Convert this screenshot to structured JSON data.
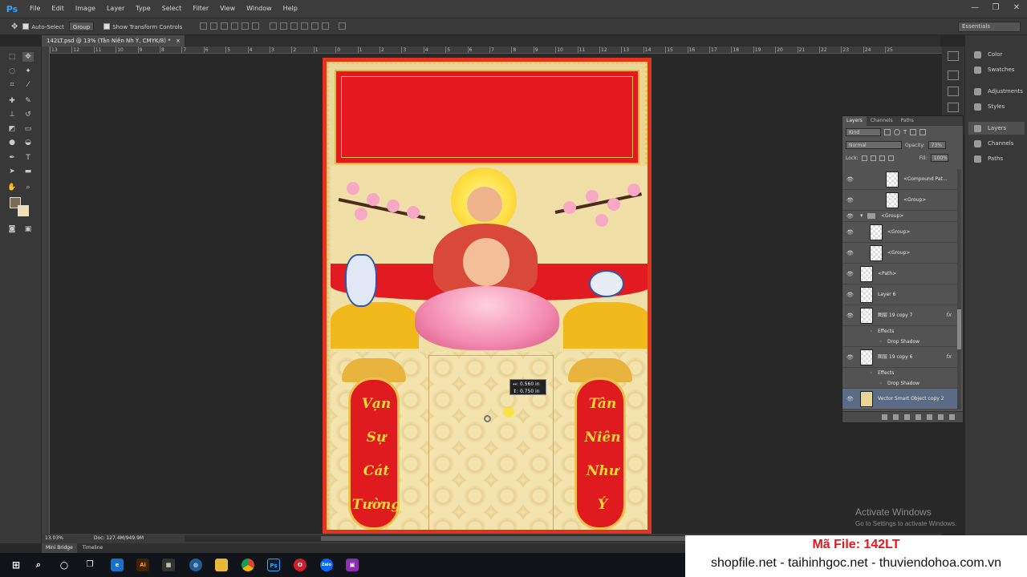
{
  "app": {
    "logo": "Ps",
    "menu": [
      "File",
      "Edit",
      "Image",
      "Layer",
      "Type",
      "Select",
      "Filter",
      "View",
      "Window",
      "Help"
    ],
    "window_controls": [
      "—",
      "❐",
      "✕"
    ]
  },
  "options_bar": {
    "auto_select_label": "Auto-Select",
    "auto_select_target": "Group",
    "show_transform_label": "Show Transform Controls",
    "workspace": "Essentials"
  },
  "document": {
    "tab_title": "142LT.psd @ 13% (Tân Niên Nh Ý, CMYK/8) *",
    "tab_close": "×",
    "ruler_ticks": [
      "13",
      "12",
      "11",
      "10",
      "9",
      "8",
      "7",
      "6",
      "5",
      "4",
      "3",
      "2",
      "1",
      "0",
      "1",
      "2",
      "3",
      "4",
      "5",
      "6",
      "7",
      "8",
      "9",
      "10",
      "11",
      "12",
      "13",
      "14",
      "15",
      "16",
      "17",
      "18",
      "19",
      "20",
      "21",
      "22",
      "23",
      "24",
      "25"
    ],
    "left_scroll_text": [
      "Vạn",
      "Sự",
      "Cát",
      "Tường"
    ],
    "right_scroll_text": [
      "Tân",
      "Niên",
      "Như",
      "Ý"
    ],
    "tooltip_w": "↔: 0.560 in",
    "tooltip_h": "↕: 0.750 in"
  },
  "status": {
    "zoom": "13.03%",
    "doc_size": "Doc: 127.4M/949.9M"
  },
  "bottom_tabs": [
    "Mini Bridge",
    "Timeline"
  ],
  "right_panels": [
    "Color",
    "Swatches",
    "Adjustments",
    "Styles",
    "Layers",
    "Channels",
    "Paths"
  ],
  "layers_panel": {
    "tabs": [
      "Layers",
      "Channels",
      "Paths"
    ],
    "filter": "Kind",
    "blend_mode": "Normal",
    "opacity_label": "Opacity:",
    "opacity_value": "73%",
    "lock_label": "Lock:",
    "fill_label": "Fill:",
    "fill_value": "100%",
    "layers": [
      {
        "name": "<Compound Pat...",
        "indent": 2
      },
      {
        "name": "<Group>",
        "indent": 2
      },
      {
        "name": "<Group>",
        "indent": 0,
        "folder": true
      },
      {
        "name": "<Group>",
        "indent": 1
      },
      {
        "name": "<Group>",
        "indent": 1
      },
      {
        "name": "<Path>",
        "indent": 0
      },
      {
        "name": "Layer 6",
        "indent": 0
      },
      {
        "name": "图层 19 copy 7",
        "indent": 0,
        "fx": true
      },
      {
        "name": "Effects",
        "indent": 1,
        "sub": true
      },
      {
        "name": "Drop Shadow",
        "indent": 2,
        "sub": true
      },
      {
        "name": "图层 19 copy 6",
        "indent": 0,
        "fx": true
      },
      {
        "name": "Effects",
        "indent": 1,
        "sub": true
      },
      {
        "name": "Drop Shadow",
        "indent": 2,
        "sub": true
      },
      {
        "name": "Vector Smart Object copy 2",
        "indent": 0,
        "selected": true
      }
    ],
    "fx_label": "fx"
  },
  "watermark": {
    "activate_title": "Activate Windows",
    "activate_sub": "Go to Settings to activate Windows.",
    "file_code": "Mã File: 142LT",
    "sites": "shopfile.net - taihinhgoc.net - thuviendohoa.com.vn"
  },
  "taskbar": {
    "icons": [
      "windows-start",
      "search",
      "cortana",
      "task-view",
      "edge",
      "illustrator",
      "app-store",
      "network",
      "file-explorer",
      "chrome",
      "photoshop",
      "opera",
      "zalo",
      "teams"
    ],
    "ai_label": "Ai",
    "ps_label": "Ps",
    "zalo_label": "Zalo"
  },
  "colors": {
    "accent": "#e3191f",
    "gold": "#f2b91c",
    "panel": "#535353"
  }
}
